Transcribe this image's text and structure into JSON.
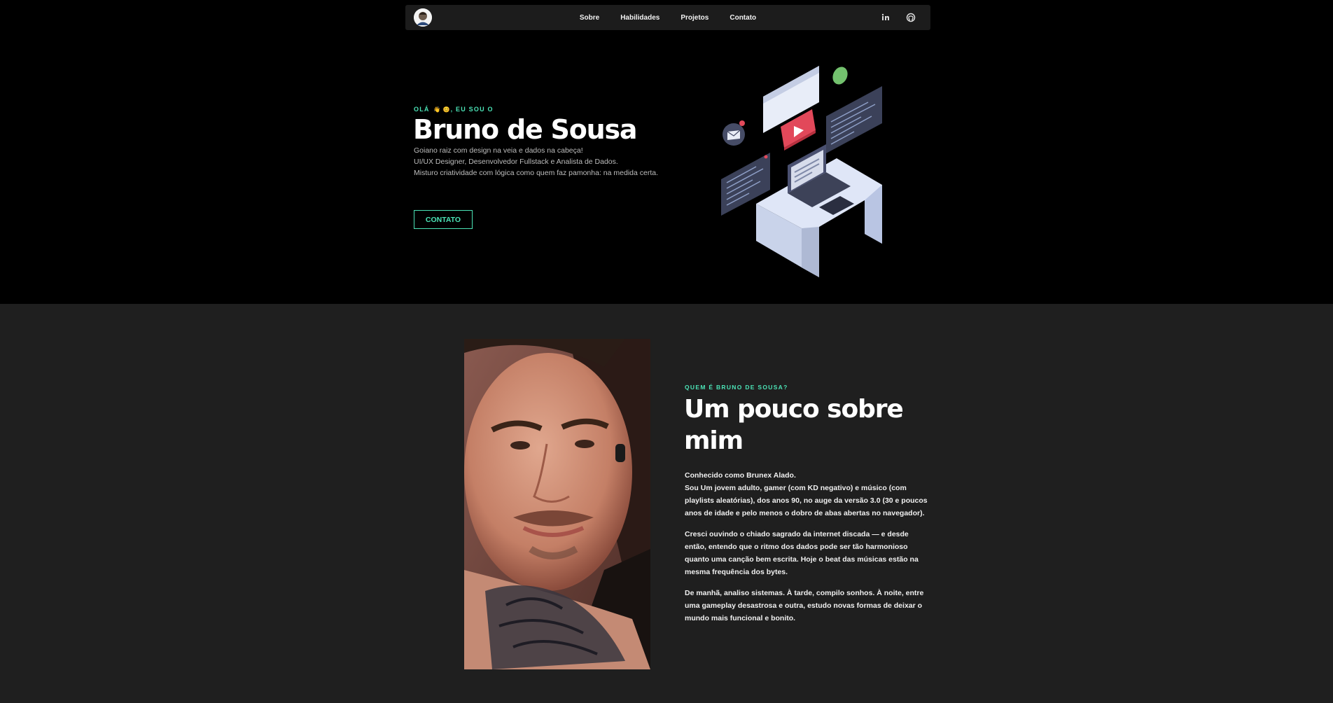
{
  "nav": {
    "links": [
      "Sobre",
      "Habilidades",
      "Projetos",
      "Contato"
    ],
    "social": [
      "linkedin-icon",
      "github-icon"
    ]
  },
  "hero": {
    "eyebrow_pre": "OLÁ",
    "eyebrow_post": ", EU SOU O",
    "name": "Bruno de Sousa",
    "desc": [
      "Goiano raiz com design na veia e dados na cabeça!",
      "UI/UX Designer, Desenvolvedor Fullstack e Analista de Dados.",
      "Misturo criatividade com lógica como quem faz pamonha: na medida certa."
    ],
    "cta": "CONTATO"
  },
  "about": {
    "eyebrow": "QUEM É BRUNO DE SOUSA?",
    "title": "Um pouco sobre mim",
    "p1_line1": "Conhecido como Brunex Alado.",
    "p1_line2": "Sou Um jovem adulto, gamer (com KD negativo) e músico (com playlists aleatórias), dos anos 90, no auge da versão 3.0 (30 e poucos anos de idade e pelo menos o dobro de abas abertas no navegador).",
    "p2": "Cresci ouvindo o chiado sagrado da internet discada — e desde então, entendo que o ritmo dos dados pode ser tão harmonioso quanto uma canção bem escrita. Hoje o beat das músicas estão na mesma frequência dos bytes.",
    "p3": "De manhã, analiso sistemas. À tarde, compilo sonhos. À noite, entre uma gameplay desastrosa e outra, estudo novas formas de deixar o mundo mais funcional e bonito."
  },
  "colors": {
    "accent": "#4be3b6",
    "hero_bg": "#000000",
    "about_bg": "#1f1f1f",
    "nav_bg": "#1c1c1c"
  }
}
